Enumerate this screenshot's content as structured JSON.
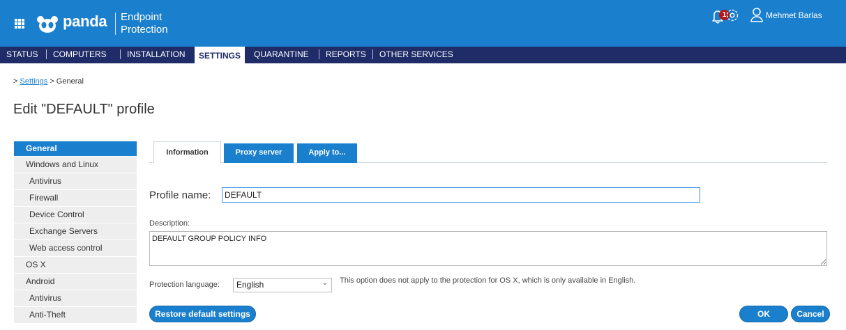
{
  "header": {
    "logo_text": "panda",
    "product_line1": "Endpoint",
    "product_line2": "Protection",
    "notification_count": "1",
    "user_name": "Mehmet Barlas",
    "brand_color": "#1a7fcd",
    "nav_color": "#1f2c68"
  },
  "nav": {
    "items": [
      "STATUS",
      "COMPUTERS",
      "INSTALLATION",
      "SETTINGS",
      "QUARANTINE",
      "REPORTS",
      "OTHER SERVICES"
    ],
    "active": "SETTINGS"
  },
  "breadcrumb": {
    "prefix": ">",
    "link": "Settings",
    "current": "> General"
  },
  "page_title": "Edit \"DEFAULT\" profile",
  "sidebar": {
    "items": [
      {
        "label": "General",
        "active": true
      },
      {
        "label": "Windows and Linux"
      },
      {
        "label": "Antivirus"
      },
      {
        "label": "Firewall"
      },
      {
        "label": "Device Control"
      },
      {
        "label": "Exchange Servers"
      },
      {
        "label": "Web access control"
      },
      {
        "label": "OS X"
      },
      {
        "label": "Android"
      },
      {
        "label": "Antivirus"
      },
      {
        "label": "Anti-Theft"
      }
    ]
  },
  "tabs": [
    "Information",
    "Proxy server",
    "Apply to..."
  ],
  "form": {
    "profile_name_label": "Profile name:",
    "profile_name_value": "DEFAULT",
    "description_label": "Description:",
    "description_value": "DEFAULT GROUP POLICY INFO",
    "language_label": "Protection language:",
    "language_value": "English",
    "language_note": "This option does not apply to the protection for OS X, which is only available in English."
  },
  "buttons": {
    "restore": "Restore default settings",
    "ok": "OK",
    "cancel": "Cancel"
  }
}
